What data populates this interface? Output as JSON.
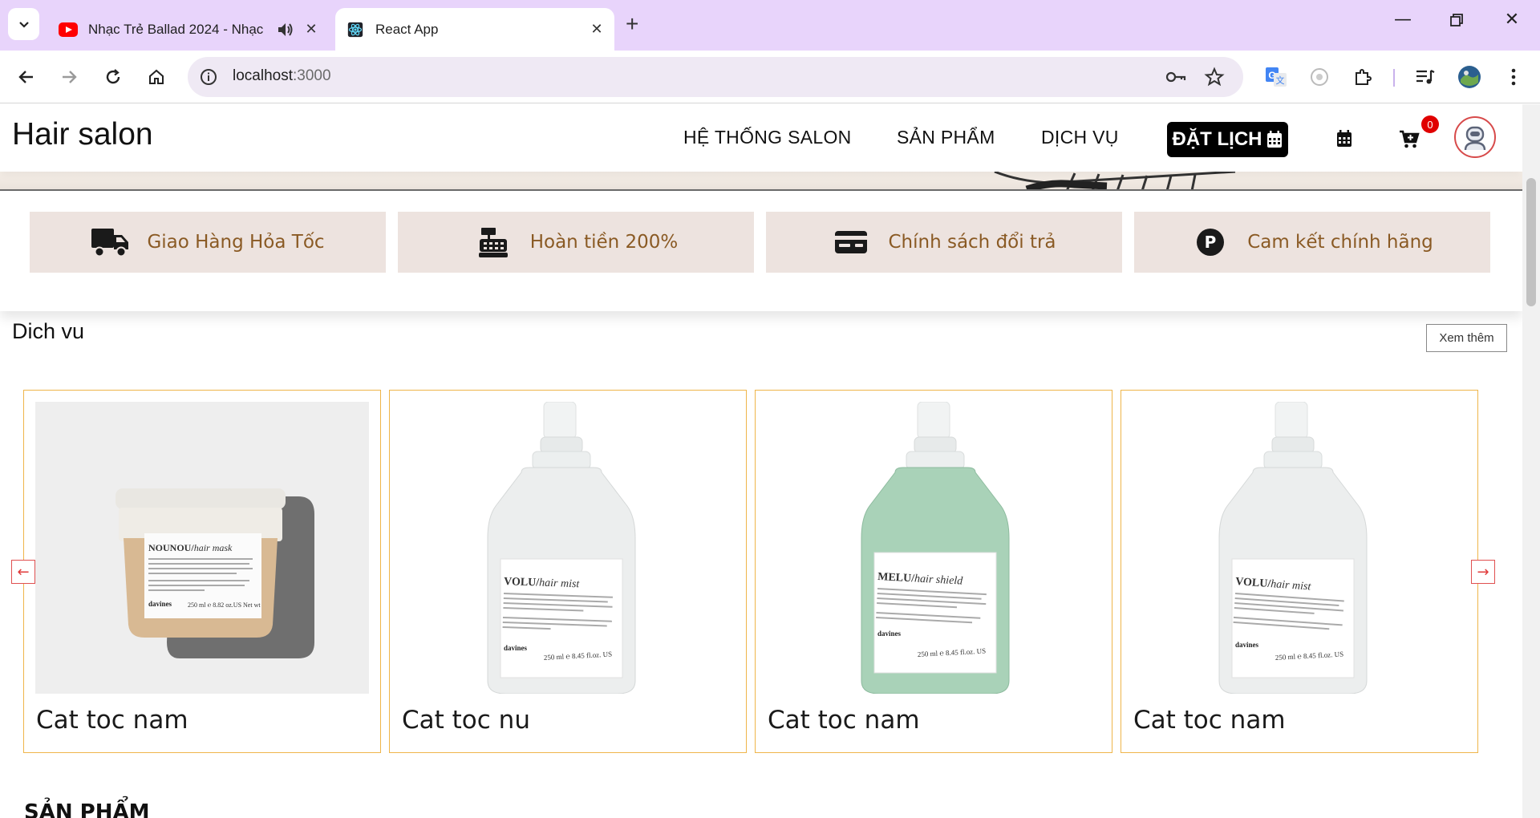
{
  "browser": {
    "tabs": [
      {
        "title": "Nhạc Trẻ Ballad 2024 - Nhạc",
        "favicon": "youtube-icon",
        "audio": true
      },
      {
        "title": "React App",
        "favicon": "react-icon",
        "active": true
      }
    ],
    "address": {
      "host": "localhost",
      "port": ":3000"
    }
  },
  "site": {
    "logo": "Hair salon",
    "menu": [
      "HỆ THỐNG SALON",
      "SẢN PHẨM",
      "DỊCH VỤ"
    ],
    "book_label": "ĐẶT LỊCH",
    "cart_count": "0"
  },
  "features": [
    {
      "label": "Giao Hàng Hỏa Tốc",
      "icon": "truck-icon"
    },
    {
      "label": "Hoàn tiền 200%",
      "icon": "cash-register-icon"
    },
    {
      "label": "Chính sách đổi trả",
      "icon": "id-card-icon"
    },
    {
      "label": "Cam kết chính hãng",
      "icon": "parking-p-icon"
    }
  ],
  "services": {
    "title": "Dich vu",
    "see_more": "Xem thêm",
    "cards": [
      {
        "name": "Cat toc nam",
        "product": {
          "brand": "NOUNOU",
          "kind": "hair mask",
          "maker": "davines",
          "volume": "250 ml ℮ 8.82 oz.US Net wt"
        }
      },
      {
        "name": "Cat toc nu",
        "product": {
          "brand": "VOLU",
          "kind": "hair mist",
          "maker": "davines",
          "volume": "250 ml ℮ 8.45 fl.oz. US"
        }
      },
      {
        "name": "Cat toc nam",
        "product": {
          "brand": "MELU",
          "kind": "hair shield",
          "maker": "davines",
          "volume": "250 ml ℮ 8.45 fl.oz. US"
        }
      },
      {
        "name": "Cat toc nam",
        "product": {
          "brand": "VOLU",
          "kind": "hair mist",
          "maker": "davines",
          "volume": "250 ml ℮ 8.45 fl.oz. US"
        }
      }
    ]
  },
  "products_section": {
    "title": "SẢN PHẨM"
  },
  "colors": {
    "tabbar": "#e8d4fb",
    "feature_bg": "#ede3df",
    "feature_text": "#8a5a24",
    "card_border": "#efb54a",
    "arrow": "#e03a3a"
  }
}
